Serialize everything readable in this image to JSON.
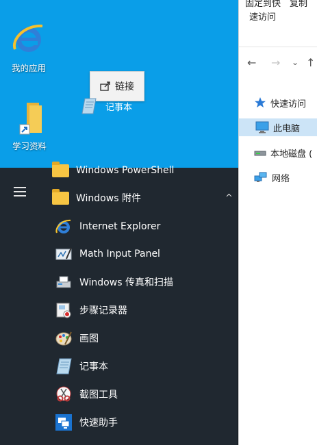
{
  "desktop": {
    "icons": [
      {
        "label": "我的应用",
        "icon": "internet-explorer-icon"
      },
      {
        "label": "学习资料",
        "icon": "folder-shortcut-icon"
      }
    ],
    "tooltip": {
      "label": "链接",
      "icon": "shortcut-arrow-icon"
    },
    "dragged_item": {
      "label": "记事本",
      "icon": "notepad-icon"
    }
  },
  "explorer": {
    "ribbon": {
      "pin_label": "固定到快",
      "pin_label_2": "速访问",
      "copy_label": "复制"
    },
    "nav": {
      "back": "←",
      "forward": "→",
      "dropdown": "⌄",
      "up": "↑"
    },
    "tree": [
      {
        "label": "快速访问",
        "icon": "star-icon"
      },
      {
        "label": "此电脑",
        "icon": "computer-icon",
        "selected": true
      },
      {
        "label": "本地磁盘 (",
        "icon": "drive-icon"
      },
      {
        "label": "网络",
        "icon": "network-icon"
      }
    ]
  },
  "start_menu": {
    "items": [
      {
        "label": "Windows PowerShell",
        "icon": "folder-icon"
      },
      {
        "label": "Windows 附件",
        "icon": "folder-icon",
        "expanded": true
      },
      {
        "label": "Internet Explorer",
        "icon": "internet-explorer-icon"
      },
      {
        "label": "Math Input Panel",
        "icon": "math-input-panel-icon"
      },
      {
        "label": "Windows 传真和扫描",
        "icon": "fax-scan-icon"
      },
      {
        "label": "步骤记录器",
        "icon": "steps-recorder-icon"
      },
      {
        "label": "画图",
        "icon": "paint-palette-icon"
      },
      {
        "label": "记事本",
        "icon": "notepad-icon"
      },
      {
        "label": "截图工具",
        "icon": "snipping-tool-icon"
      },
      {
        "label": "快速助手",
        "icon": "quick-assist-icon"
      }
    ],
    "collapse_glyph": "^"
  },
  "colors": {
    "desktop_blue": "#0a9ee8",
    "start_bg": "#202830",
    "folder": "#f7c543",
    "selection": "#cce4f7"
  }
}
